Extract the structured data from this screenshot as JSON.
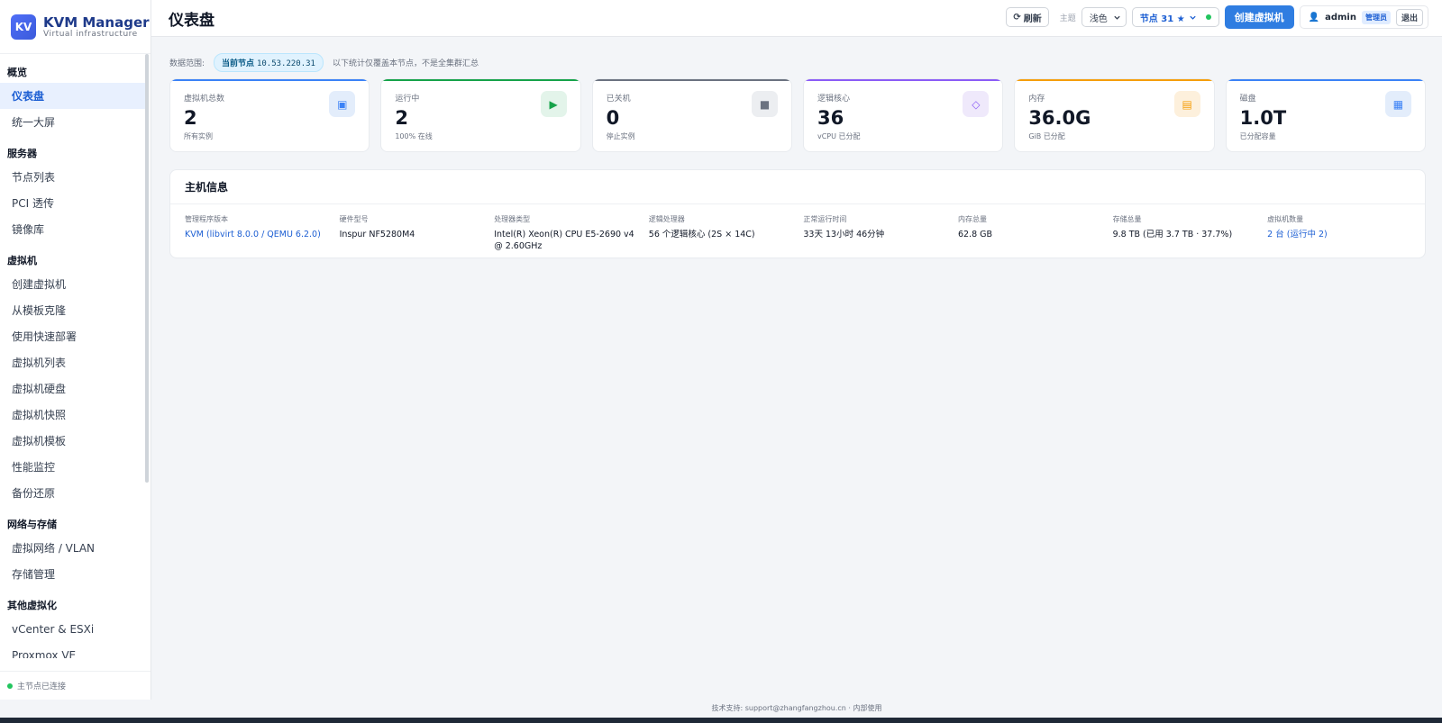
{
  "brand": {
    "logo": "KV",
    "name": "KVM Manager",
    "subtitle": "Virtual infrastructure"
  },
  "sidebar": {
    "groups": [
      {
        "title": "概览",
        "items": [
          "仪表盘",
          "统一大屏"
        ]
      },
      {
        "title": "服务器",
        "items": [
          "节点列表",
          "PCI 透传",
          "镜像库"
        ]
      },
      {
        "title": "虚拟机",
        "items": [
          "创建虚拟机",
          "从模板克隆",
          "使用快速部署",
          "虚拟机列表",
          "虚拟机硬盘",
          "虚拟机快照",
          "虚拟机模板",
          "性能监控",
          "备份还原"
        ]
      },
      {
        "title": "网络与存储",
        "items": [
          "虚拟网络 / VLAN",
          "存储管理"
        ]
      },
      {
        "title": "其他虚拟化",
        "items": [
          "vCenter & ESXi",
          "Proxmox VE"
        ]
      },
      {
        "title": "容器",
        "items": []
      }
    ],
    "active": "仪表盘",
    "footer_status": "主节点已连接"
  },
  "header": {
    "title": "仪表盘",
    "refresh_label": "刷新",
    "theme_label": "主题",
    "theme_value": "浅色",
    "node_label": "节点 31 ★",
    "create_vm_label": "创建虚拟机",
    "user": "admin",
    "role": "管理员",
    "logout_label": "退出"
  },
  "scope": {
    "label": "数据范围:",
    "badge_prefix": "当前节点",
    "ip": "10.53.220.31",
    "note": "以下统计仅覆盖本节点，不是全集群汇总"
  },
  "stats": [
    {
      "label": "虚拟机总数",
      "value": "2",
      "sub": "所有实例",
      "icon": "chip-icon",
      "glyph": "▣",
      "color": "#3b82f6",
      "bg": "#e3edfb"
    },
    {
      "label": "运行中",
      "value": "2",
      "sub": "100% 在线",
      "icon": "play-icon",
      "glyph": "▶",
      "color": "#16a34a",
      "bg": "#e3f4ea"
    },
    {
      "label": "已关机",
      "value": "0",
      "sub": "停止实例",
      "icon": "stop-icon",
      "glyph": "■",
      "color": "#6b7280",
      "bg": "#eceef1"
    },
    {
      "label": "逻辑核心",
      "value": "36",
      "sub": "vCPU 已分配",
      "icon": "core-icon",
      "glyph": "◇",
      "color": "#8b5cf6",
      "bg": "#efe9fb"
    },
    {
      "label": "内存",
      "value": "36.0G",
      "sub": "GiB 已分配",
      "icon": "memory-icon",
      "glyph": "▤",
      "color": "#f59e0b",
      "bg": "#fdf0dc"
    },
    {
      "label": "磁盘",
      "value": "1.0T",
      "sub": "已分配容量",
      "icon": "disk-icon",
      "glyph": "▦",
      "color": "#3b82f6",
      "bg": "#e3edfb"
    }
  ],
  "host": {
    "title": "主机信息",
    "fields": [
      {
        "k": "管理程序版本",
        "v": "KVM (libvirt 8.0.0 / QEMU 6.2.0)",
        "link": true
      },
      {
        "k": "硬件型号",
        "v": "Inspur NF5280M4",
        "link": false
      },
      {
        "k": "处理器类型",
        "v": "Intel(R) Xeon(R) CPU E5-2690 v4 @ 2.60GHz",
        "link": false
      },
      {
        "k": "逻辑处理器",
        "v": "56 个逻辑核心 (2S × 14C)",
        "link": false
      },
      {
        "k": "正常运行时间",
        "v": "33天 13小时 46分钟",
        "link": false
      },
      {
        "k": "内存总量",
        "v": "62.8 GB",
        "link": false
      },
      {
        "k": "存储总量",
        "v": "9.8 TB (已用 3.7 TB · 37.7%)",
        "link": false
      },
      {
        "k": "虚拟机数量",
        "v": "2 台 (运行中 2)",
        "link": true
      }
    ]
  },
  "footer": "技术支持: support@zhangfangzhou.cn · 内部使用"
}
